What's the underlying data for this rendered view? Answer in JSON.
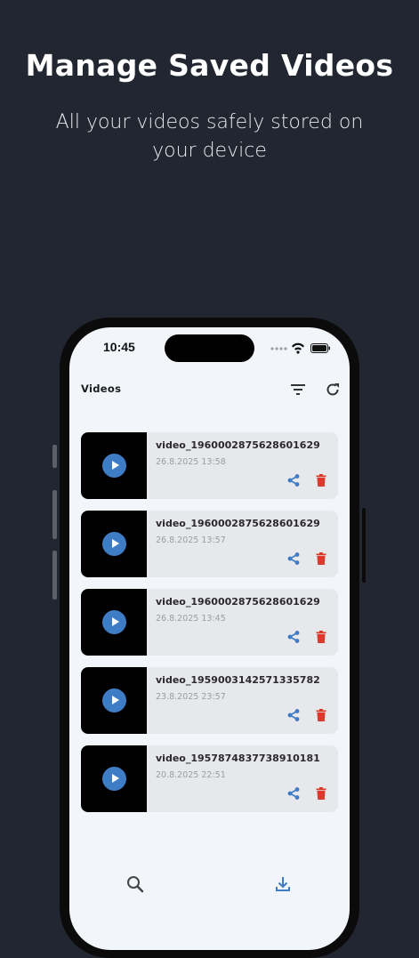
{
  "promo": {
    "headline": "Manage Saved Videos",
    "subline": "All your videos safely stored on your device"
  },
  "status_bar": {
    "time": "10:45",
    "icons": [
      "signal-dots-icon",
      "wifi-icon",
      "battery-icon"
    ]
  },
  "app": {
    "title": "Videos",
    "toolbar_icons": [
      "filter-icon",
      "refresh-icon"
    ]
  },
  "videos": [
    {
      "name": "video_1960002875628601629",
      "date": "26.8.2025  13:58"
    },
    {
      "name": "video_1960002875628601629",
      "date": "26.8.2025  13:57"
    },
    {
      "name": "video_1960002875628601629",
      "date": "26.8.2025  13:45"
    },
    {
      "name": "video_1959003142571335782",
      "date": "23.8.2025  23:57"
    },
    {
      "name": "video_1957874837738910181",
      "date": "20.8.2025  22:51"
    }
  ],
  "bottom_nav": [
    "search-icon",
    "download-icon"
  ],
  "colors": {
    "background": "#212630",
    "screen": "#f2f5f9",
    "card": "#e7e8ec",
    "accent_blue": "#3e7cc6",
    "delete_red": "#d93a2b"
  }
}
